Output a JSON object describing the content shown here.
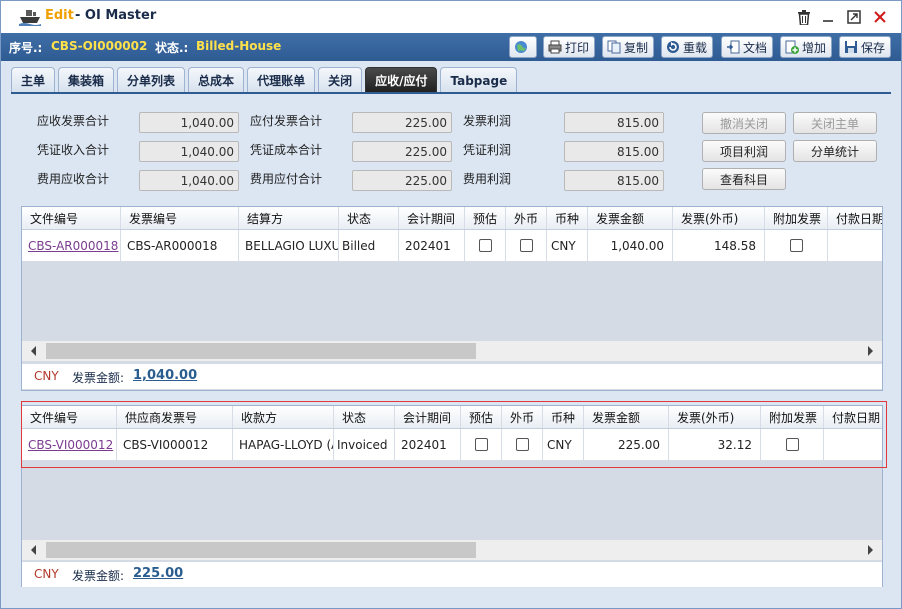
{
  "window": {
    "edit_label": "Edit",
    "title": " - OI Master",
    "controls": {
      "delete": "trash-icon",
      "minimize": "minimize-icon",
      "maximize": "maximize-icon",
      "close": "close-icon"
    }
  },
  "info": {
    "seq_label": "序号.:",
    "seq_value": "CBS-OI000002",
    "status_label": "状态.:",
    "status_value": "Billed-House"
  },
  "toolbar": {
    "print": "打印",
    "copy": "复制",
    "reload": "重载",
    "docs": "文档",
    "add": "增加",
    "save": "保存"
  },
  "tabs": [
    "主单",
    "集装箱",
    "分单列表",
    "总成本",
    "代理账单",
    "关闭",
    "应收/应付",
    "Tabpage"
  ],
  "active_tab": "应收/应付",
  "summary": {
    "ar_invoice_total_label": "应收发票合计",
    "ar_invoice_total": "1,040.00",
    "ap_invoice_total_label": "应付发票合计",
    "ap_invoice_total": "225.00",
    "invoice_profit_label": "发票利润",
    "invoice_profit": "815.00",
    "voucher_income_label": "凭证收入合计",
    "voucher_income": "1,040.00",
    "voucher_cost_label": "凭证成本合计",
    "voucher_cost": "225.00",
    "voucher_profit_label": "凭证利润",
    "voucher_profit": "815.00",
    "fee_receivable_label": "费用应收合计",
    "fee_receivable": "1,040.00",
    "fee_payable_label": "费用应付合计",
    "fee_payable": "225.00",
    "fee_profit_label": "费用利润",
    "fee_profit": "815.00"
  },
  "actions": {
    "cancel_close": "撤消关闭",
    "close_master": "关闭主单",
    "project_profit": "项目利润",
    "hbl_stats": "分单统计",
    "view_accounts": "查看科目"
  },
  "ar_grid": {
    "headers": [
      "文件编号",
      "发票编号",
      "结算方",
      "状态",
      "会计期间",
      "预估",
      "外币",
      "币种",
      "发票金额",
      "发票(外币)",
      "附加发票",
      "付款日期"
    ],
    "rows": [
      {
        "file_no": "CBS-AR000018",
        "invoice_no": "CBS-AR000018",
        "party": "BELLAGIO LUXURY",
        "status": "Billed",
        "period": "202401",
        "currency": "CNY",
        "amount": "1,040.00",
        "amount_fc": "148.58"
      }
    ],
    "footer_currency": "CNY",
    "footer_label": "发票金额:",
    "footer_total": "1,040.00"
  },
  "ap_grid": {
    "headers": [
      "文件编号",
      "供应商发票号",
      "收款方",
      "状态",
      "会计期间",
      "预估",
      "外币",
      "币种",
      "发票金额",
      "发票(外币)",
      "附加发票",
      "付款日期"
    ],
    "rows": [
      {
        "file_no": "CBS-VI000012",
        "invoice_no": "CBS-VI000012",
        "party": "HAPAG-LLOYD (A",
        "status": "Invoiced",
        "period": "202401",
        "currency": "CNY",
        "amount": "225.00",
        "amount_fc": "32.12"
      }
    ],
    "footer_currency": "CNY",
    "footer_label": "发票金额:",
    "footer_total": "225.00"
  }
}
